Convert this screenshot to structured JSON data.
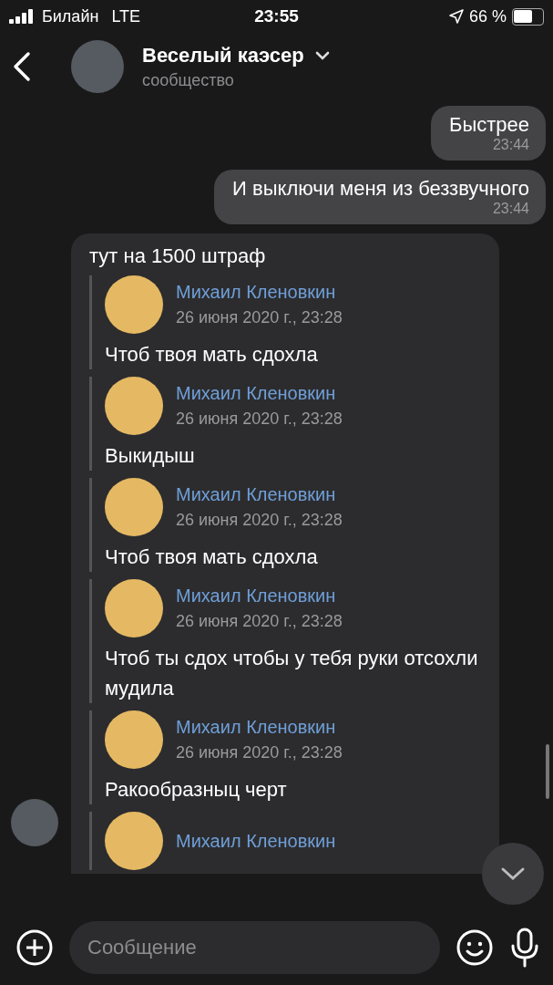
{
  "status_bar": {
    "carrier": "Билайн",
    "network": "LTE",
    "time": "23:55",
    "battery_percent": "66 %",
    "battery": {
      "level": 0.66
    }
  },
  "header": {
    "title": "Веселый каэсер",
    "subtitle": "сообщество"
  },
  "messages": [
    {
      "kind": "outgoing",
      "text": "Быстрее",
      "time": "23:44"
    },
    {
      "kind": "outgoing",
      "text": "И выключи меня из беззвучного",
      "time": "23:44"
    },
    {
      "kind": "incoming",
      "text": "тут на 1500 штраф",
      "quotes": [
        {
          "author": "Михаил Кленовкин",
          "date": "26 июня 2020 г., 23:28",
          "text": "Чтоб твоя мать сдохла"
        },
        {
          "author": "Михаил Кленовкин",
          "date": "26 июня 2020 г., 23:28",
          "text": "Выкидыш"
        },
        {
          "author": "Михаил Кленовкин",
          "date": "26 июня 2020 г., 23:28",
          "text": "Чтоб твоя мать сдохла"
        },
        {
          "author": "Михаил Кленовкин",
          "date": "26 июня 2020 г., 23:28",
          "text": "Чтоб ты сдох чтобы у тебя руки отсохли мудила"
        },
        {
          "author": "Михаил Кленовкин",
          "date": "26 июня 2020 г., 23:28",
          "text": "Ракообразныц черт"
        },
        {
          "author": "Михаил Кленовкин"
        }
      ]
    }
  ],
  "composer": {
    "placeholder": "Сообщение"
  }
}
